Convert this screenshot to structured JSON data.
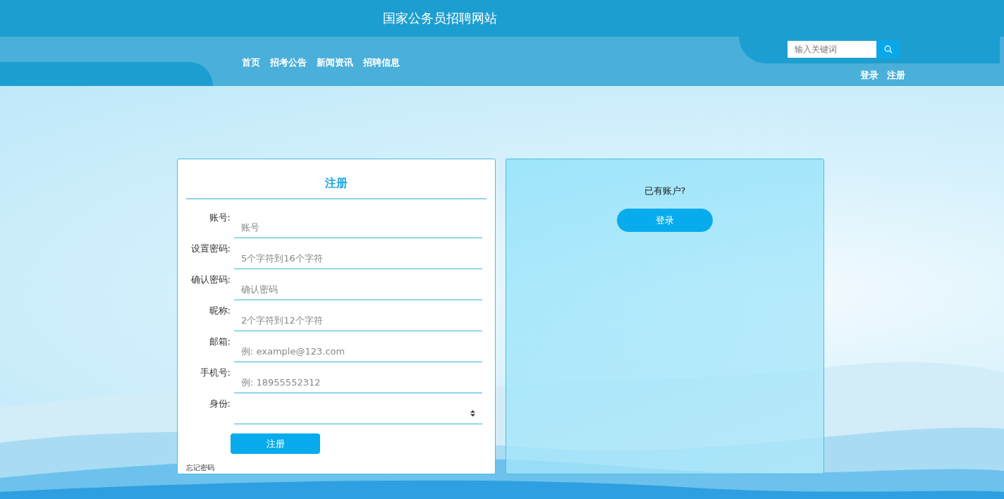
{
  "site_title": "国家公务员招聘网站",
  "nav": [
    {
      "label": "首页"
    },
    {
      "label": "招考公告"
    },
    {
      "label": "新闻资讯"
    },
    {
      "label": "招聘信息"
    }
  ],
  "search": {
    "placeholder": "输入关键词"
  },
  "auth_links": [
    "登录",
    "注册"
  ],
  "register_form": {
    "title": "注册",
    "fields": [
      {
        "label": "账号:",
        "kind": "text",
        "placeholder": "账号"
      },
      {
        "label": "设置密码:",
        "kind": "text",
        "placeholder": "5个字符到16个字符"
      },
      {
        "label": "确认密码:",
        "kind": "text",
        "placeholder": "确认密码"
      },
      {
        "label": "昵称:",
        "kind": "text",
        "placeholder": "2个字符到12个字符"
      },
      {
        "label": "邮箱:",
        "kind": "text",
        "placeholder": "例: example@123.com"
      },
      {
        "label": "手机号:",
        "kind": "text",
        "placeholder": "例: 18955552312"
      },
      {
        "label": "身份:",
        "kind": "select"
      }
    ],
    "submit": "注册",
    "forgot_link": "忘记密码"
  },
  "login_panel": {
    "prompt": "已有账户?",
    "button": "登录"
  }
}
